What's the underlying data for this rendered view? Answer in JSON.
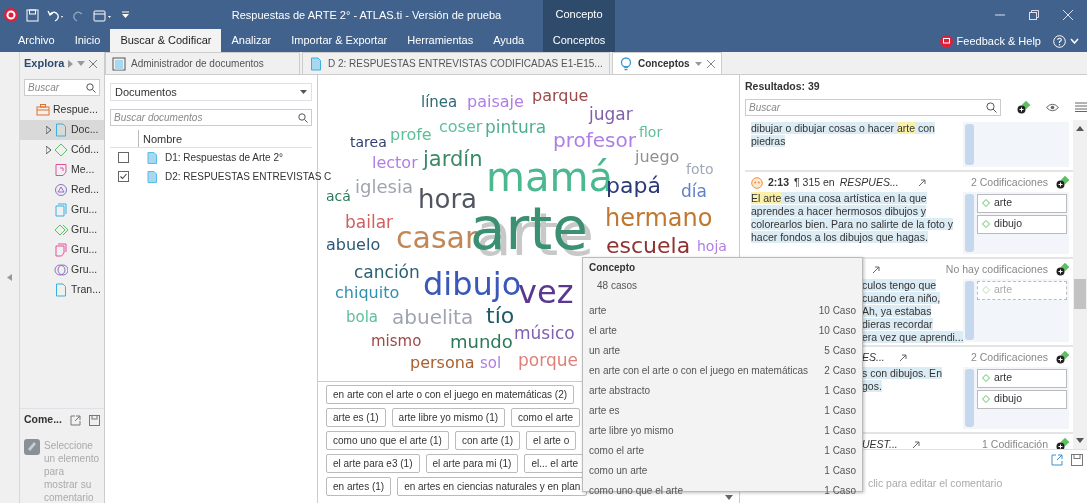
{
  "title_bar": {
    "title": "Respuestas de ARTE 2° - ATLAS.ti - Versión de prueba",
    "context_group": "Concepto"
  },
  "ribbon_tabs": [
    {
      "label": "Archivo",
      "selected": false,
      "kind": "tab"
    },
    {
      "label": "Inicio",
      "selected": false,
      "kind": "tab"
    },
    {
      "label": "Buscar & Codificar",
      "selected": true,
      "kind": "tab"
    },
    {
      "label": "Analizar",
      "selected": false,
      "kind": "tab"
    },
    {
      "label": "Importar & Exportar",
      "selected": false,
      "kind": "tab"
    },
    {
      "label": "Herramientas",
      "selected": false,
      "kind": "tab"
    },
    {
      "label": "Ayuda",
      "selected": false,
      "kind": "tab"
    },
    {
      "label": "Conceptos",
      "selected": false,
      "kind": "context"
    }
  ],
  "help": {
    "label": "Feedback & Help"
  },
  "explorer": {
    "title": "Explora",
    "search": {
      "placeholder": "Buscar"
    },
    "tree": [
      {
        "label": "Respue...",
        "kind": "project",
        "selected": false,
        "children": [
          {
            "label": "Doc...",
            "kind": "documents",
            "expandable": true,
            "selected": true
          },
          {
            "label": "Cód...",
            "kind": "codes",
            "expandable": true,
            "selected": false
          },
          {
            "label": "Me...",
            "kind": "memos",
            "expandable": false,
            "selected": false
          },
          {
            "label": "Red...",
            "kind": "networks",
            "expandable": false,
            "selected": false
          },
          {
            "label": "Gru...",
            "kind": "document_groups",
            "expandable": false,
            "selected": false
          },
          {
            "label": "Gru...",
            "kind": "code_groups",
            "expandable": false,
            "selected": false
          },
          {
            "label": "Gru...",
            "kind": "memo_groups",
            "expandable": false,
            "selected": false
          },
          {
            "label": "Gru...",
            "kind": "network_groups",
            "expandable": false,
            "selected": false
          },
          {
            "label": "Tran...",
            "kind": "transcripts",
            "expandable": false,
            "selected": false
          }
        ]
      }
    ]
  },
  "comment_panel": {
    "title": "Come...",
    "text": "Seleccione un elemento para mostrar su comentario"
  },
  "doc_tabs": [
    {
      "label": "Administrador de documentos",
      "kind": "manager",
      "selected": false
    },
    {
      "label": "D 2: RESPUESTAS ENTREVISTAS CODIFICADAS E1-E15...",
      "kind": "document",
      "selected": false
    },
    {
      "label": "Conceptos",
      "kind": "concepts",
      "selected": true
    }
  ],
  "documents": {
    "filter": "Documentos",
    "search": {
      "placeholder": "Buscar documentos"
    },
    "columns": [
      "Nombre"
    ],
    "rows": [
      {
        "name": "D1: Respuestas de Arte 2°",
        "checked": false
      },
      {
        "name": "D2: RESPUESTAS ENTREVISTAS C",
        "checked": true
      }
    ]
  },
  "word_cloud": {
    "words": [
      {
        "text": "línea",
        "color": "#2e6a78"
      },
      {
        "text": "paisaje",
        "color": "#b07ee6"
      },
      {
        "text": "parque",
        "color": "#9a4a4a"
      },
      {
        "text": "jugar",
        "color": "#8060a8"
      },
      {
        "text": "tarea",
        "color": "#2e3e70"
      },
      {
        "text": "profe",
        "color": "#5cc09a"
      },
      {
        "text": "coser",
        "color": "#5cc09a"
      },
      {
        "text": "pintura",
        "color": "#4cb090"
      },
      {
        "text": "profesor",
        "color": "#b07ee6"
      },
      {
        "text": "flor",
        "color": "#5cc09a"
      },
      {
        "text": "lector",
        "color": "#b07ee6"
      },
      {
        "text": "jardín",
        "color": "#3a8a6a"
      },
      {
        "text": "acá",
        "color": "#2a7a5a"
      },
      {
        "text": "iglesia",
        "color": "#a0a4b0"
      },
      {
        "text": "hora",
        "color": "#505560"
      },
      {
        "text": "mamá",
        "color": "#4cb890"
      },
      {
        "text": "papá",
        "color": "#2a3a78"
      },
      {
        "text": "juego",
        "color": "#909090"
      },
      {
        "text": "foto",
        "color": "#a0a8b8"
      },
      {
        "text": "día",
        "color": "#6080c8"
      },
      {
        "text": "abuelo",
        "color": "#2a5a78"
      },
      {
        "text": "bailar",
        "color": "#d06060"
      },
      {
        "text": "casar",
        "color": "#c08858"
      },
      {
        "text": "arte",
        "color": "#3a9070"
      },
      {
        "text": "hermano",
        "color": "#c07830"
      },
      {
        "text": "escuela",
        "color": "#903030"
      },
      {
        "text": "hoja",
        "color": "#b07ee6"
      },
      {
        "text": "canción",
        "color": "#2a6070"
      },
      {
        "text": "chiquito",
        "color": "#3090b0"
      },
      {
        "text": "dibujo",
        "color": "#3a58b8"
      },
      {
        "text": "vez",
        "color": "#5a3890"
      },
      {
        "text": "bola",
        "color": "#5cc09a"
      },
      {
        "text": "abuelita",
        "color": "#a0a4b0"
      },
      {
        "text": "tío",
        "color": "#205a6a"
      },
      {
        "text": "mismo",
        "color": "#a04848"
      },
      {
        "text": "mundo",
        "color": "#2a7a58"
      },
      {
        "text": "músico",
        "color": "#8060b0"
      },
      {
        "text": "persona",
        "color": "#a86030"
      },
      {
        "text": "sol",
        "color": "#b07ee6"
      },
      {
        "text": "porque",
        "color": "#e08078"
      }
    ]
  },
  "phrase_rows": [
    [
      "en arte con el arte o con el juego en matemáticas (2)"
    ],
    [
      "arte es (1)",
      "arte libre yo mismo (1)",
      "como el arte"
    ],
    [
      "como uno que el arte (1)",
      "con arte (1)",
      "el arte o"
    ],
    [
      "el arte para e3 (1)",
      "el arte para mi (1)",
      "el... el arte"
    ],
    [
      "en artes (1)",
      "en artes en ciencias naturales y en plan"
    ]
  ],
  "tooltip": {
    "title": "Concepto",
    "summary": "48 casos",
    "items": [
      {
        "label": "arte",
        "count": "10 Caso"
      },
      {
        "label": "el arte",
        "count": "10 Caso"
      },
      {
        "label": "un arte",
        "count": "5 Caso"
      },
      {
        "label": "en arte con el arte o con el juego en matemáticas",
        "count": "2 Caso"
      },
      {
        "label": "arte abstracto",
        "count": "1 Caso"
      },
      {
        "label": "arte es",
        "count": "1 Caso"
      },
      {
        "label": "arte libre yo mismo",
        "count": "1 Caso"
      },
      {
        "label": "como el arte",
        "count": "1 Caso"
      },
      {
        "label": "como un arte",
        "count": "1 Caso"
      },
      {
        "label": "como uno que el arte",
        "count": "1 Caso"
      }
    ]
  },
  "results": {
    "title": "Resultados: 39",
    "search": {
      "placeholder": "Buscar"
    },
    "quotations": [
      {
        "kind": "continued",
        "segments": [
          {
            "text": "dibujar o dibujar cosas o hacer ",
            "highlight": false
          },
          {
            "text": "arte",
            "highlight": true
          },
          {
            "text": " con piedras",
            "highlight": false
          }
        ]
      },
      {
        "kind": "full",
        "id": "2:13",
        "location": "¶ 315 en",
        "source": "RESPUES...",
        "count": "2 Codificaciones",
        "segments": [
          {
            "text": "El arte",
            "highlight": true
          },
          {
            "text": " es una cosa artística en la que aprendes a hacer hermosos dibujos y colorearlos bien. Para no salirte de la foto y hacer fondos a los dibujos que hagas.",
            "highlight": false
          }
        ],
        "codes": [
          {
            "label": "arte",
            "suggested": false
          },
          {
            "label": "dibujo",
            "suggested": false
          }
        ]
      },
      {
        "kind": "covered",
        "count": "No hay codificaciones",
        "lines": [
          "culos tengo que",
          "cuando era niño,",
          "Ah, ya estabas",
          "dieras recordar",
          "era vez que aprendi..."
        ],
        "codes": [
          {
            "label": "arte",
            "suggested": true
          }
        ]
      },
      {
        "kind": "covered",
        "source": "ES...",
        "count": "2 Codificaciones",
        "lines": [
          "s con dibujos. En",
          "gos."
        ],
        "codes": [
          {
            "label": "arte",
            "suggested": false
          },
          {
            "label": "dibujo",
            "suggested": false
          }
        ]
      },
      {
        "kind": "covered",
        "source": "UEST...",
        "count": "1 Codificación"
      }
    ],
    "comment_placeholder": "clic para editar el comentario"
  }
}
